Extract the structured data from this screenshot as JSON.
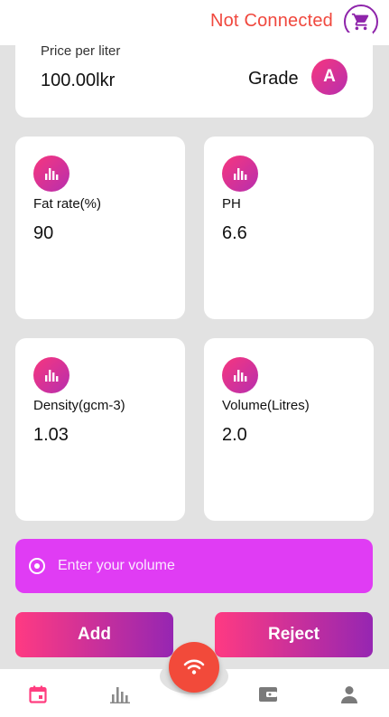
{
  "header": {
    "connection_status": "Not Connected",
    "status_color": "#f0483e",
    "cart_icon": "cart-icon"
  },
  "price_card": {
    "price_label": "Price per liter",
    "price_value": "100.00lkr",
    "grade_label": "Grade",
    "grade_value": "A"
  },
  "metrics": [
    {
      "label": "Fat rate(%)",
      "value": "90",
      "icon": "bar-chart-icon"
    },
    {
      "label": "PH",
      "value": "6.6",
      "icon": "bar-chart-icon"
    },
    {
      "label": "Density(gcm-3)",
      "value": "1.03",
      "icon": "bar-chart-icon"
    },
    {
      "label": "Volume(Litres)",
      "value": "2.0",
      "icon": "bar-chart-icon"
    }
  ],
  "volume_input": {
    "placeholder": "Enter your volume",
    "value": ""
  },
  "actions": {
    "add_label": "Add",
    "reject_label": "Reject"
  },
  "bottom_nav": {
    "items": [
      "calendar-icon",
      "bar-chart-icon",
      "wifi-icon",
      "wallet-icon",
      "person-icon"
    ],
    "active": "calendar-icon"
  },
  "colors": {
    "accent_gradient_start": "#ff3a82",
    "accent_gradient_end": "#9626b2",
    "input_bg": "#e03cf4",
    "fab": "#f24a3a",
    "background": "#e2e2e2"
  }
}
